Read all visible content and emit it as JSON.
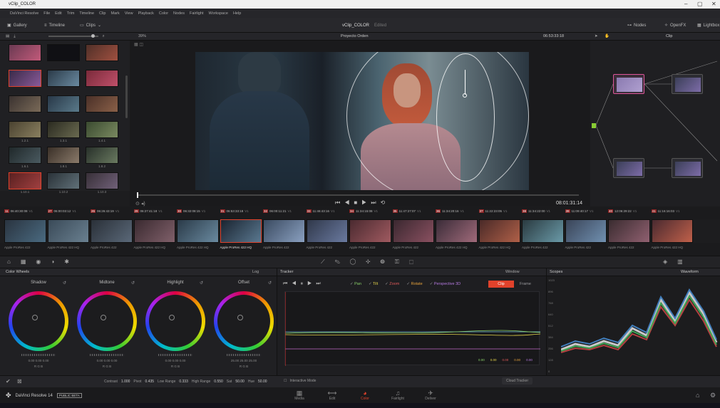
{
  "window": {
    "title": "vClip_COLOR",
    "min": "–",
    "max": "▢",
    "close": "✕"
  },
  "menu": [
    "DaVinci Resolve",
    "File",
    "Edit",
    "Trim",
    "Timeline",
    "Clip",
    "Mark",
    "View",
    "Playback",
    "Color",
    "Nodes",
    "Fairlight",
    "Workspace",
    "Help"
  ],
  "toolbar": {
    "gallery": "Gallery",
    "timeline": "Timeline",
    "clips": "Clips",
    "project": "vClip_COLOR",
    "edited": "Edited",
    "nodes": "Nodes",
    "openfx": "OpenFX",
    "lightbox": "Lightbox"
  },
  "viewer": {
    "zoom": "39%",
    "timeline_name": "Proyecto Orden",
    "timecode_top": "06:53:33:18",
    "timecode": "08:01:31:14",
    "mode": "Clip"
  },
  "media": {
    "labels": [
      "",
      "",
      "",
      "",
      "",
      "",
      "",
      "",
      "",
      "1.2.1",
      "1.3.1",
      "1.4.1",
      "1.6.1",
      "1.8.1",
      "1.8.2",
      "1.10.1",
      "1.10.2",
      "1.10.3"
    ]
  },
  "timeline_clips": [
    {
      "n": "11",
      "tc": "06:40:30:08",
      "v": "V1",
      "f": "Apple ProRes 422"
    },
    {
      "n": "27",
      "tc": "06:00:03:12",
      "v": "V1",
      "f": "Apple ProRes 422 HQ"
    },
    {
      "n": "26",
      "tc": "06:26:43:19",
      "v": "V1",
      "f": "Apple ProRes 422"
    },
    {
      "n": "29",
      "tc": "06:27:41:18",
      "v": "V1",
      "f": "Apple ProRes 422 HQ"
    },
    {
      "n": "30",
      "tc": "06:32:08:15",
      "v": "V1",
      "f": "Apple ProRes 422 HQ"
    },
    {
      "n": "31",
      "tc": "06:53:33:18",
      "v": "V1",
      "f": "Apple ProRes 422 HQ"
    },
    {
      "n": "32",
      "tc": "06:00:11:21",
      "v": "V1",
      "f": "Apple ProRes 422"
    },
    {
      "n": "33",
      "tc": "11:46:43:16",
      "v": "V1",
      "f": "Apple ProRes 422"
    },
    {
      "n": "34",
      "tc": "11:34:15:08",
      "v": "V1",
      "f": "Apple ProRes 422"
    },
    {
      "n": "35",
      "tc": "11:47:27:07",
      "v": "V1",
      "f": "Apple ProRes 422"
    },
    {
      "n": "36",
      "tc": "11:34:20:16",
      "v": "V1",
      "f": "Apple ProRes 422 HQ"
    },
    {
      "n": "37",
      "tc": "11:22:23:05",
      "v": "V1",
      "f": "Apple ProRes 422 HQ"
    },
    {
      "n": "38",
      "tc": "11:34:22:00",
      "v": "V1",
      "f": "Apple ProRes 422"
    },
    {
      "n": "39",
      "tc": "11:09:40:17",
      "v": "V1",
      "f": "Apple ProRes 422"
    },
    {
      "n": "40",
      "tc": "12:06:29:22",
      "v": "V1",
      "f": "Apple ProRes 422"
    },
    {
      "n": "41",
      "tc": "11:16:16:03",
      "v": "V1",
      "f": "Apple ProRes 422 HQ"
    }
  ],
  "wheels": {
    "title": "Color Wheels",
    "mode": "Log",
    "items": [
      {
        "name": "Shadow",
        "vals": "0.00  0.00  0.00",
        "rgb": "R  G  B"
      },
      {
        "name": "Midtone",
        "vals": "0.00  0.00  0.00",
        "rgb": "R  G  B"
      },
      {
        "name": "Highlight",
        "vals": "0.00  0.00  0.00",
        "rgb": "R  G  B"
      },
      {
        "name": "Offset",
        "vals": "25.00  25.00  25.00",
        "rgb": "R  G  B"
      }
    ]
  },
  "tracker": {
    "title": "Tracker",
    "window": "Window",
    "pan": "Pan",
    "tilt": "Tilt",
    "zoom": "Zoom",
    "rotate": "Rotate",
    "perspective": "Perspective 3D",
    "clip": "Clip",
    "frame": "Frame",
    "values": [
      "0.00",
      "0.00",
      "0.00",
      "0.00",
      "0.00"
    ],
    "interactive": "Interactive Mode",
    "cloud": "Cloud Tracker"
  },
  "scopes": {
    "title": "Scopes",
    "mode": "Waveform",
    "ticks": [
      "1023",
      "896",
      "768",
      "640",
      "512",
      "384",
      "256",
      "128",
      "0"
    ]
  },
  "controls": {
    "contrast_label": "Contrast",
    "contrast": "1.000",
    "pivot_label": "Pivot",
    "pivot": "0.435",
    "lowrange_label": "Low Range",
    "lowrange": "0.333",
    "highrange_label": "High Range",
    "highrange": "0.550",
    "sat_label": "Sat",
    "sat": "50.00",
    "hue_label": "Hue",
    "hue": "50.00"
  },
  "app": {
    "name": "DaVinci Resolve 14",
    "badge": "PUBLIC BETA"
  },
  "pages": [
    "Media",
    "Edit",
    "Color",
    "Fairlight",
    "Deliver"
  ],
  "colors": {
    "accent": "#e0422b",
    "active_page": "#e0422b"
  }
}
